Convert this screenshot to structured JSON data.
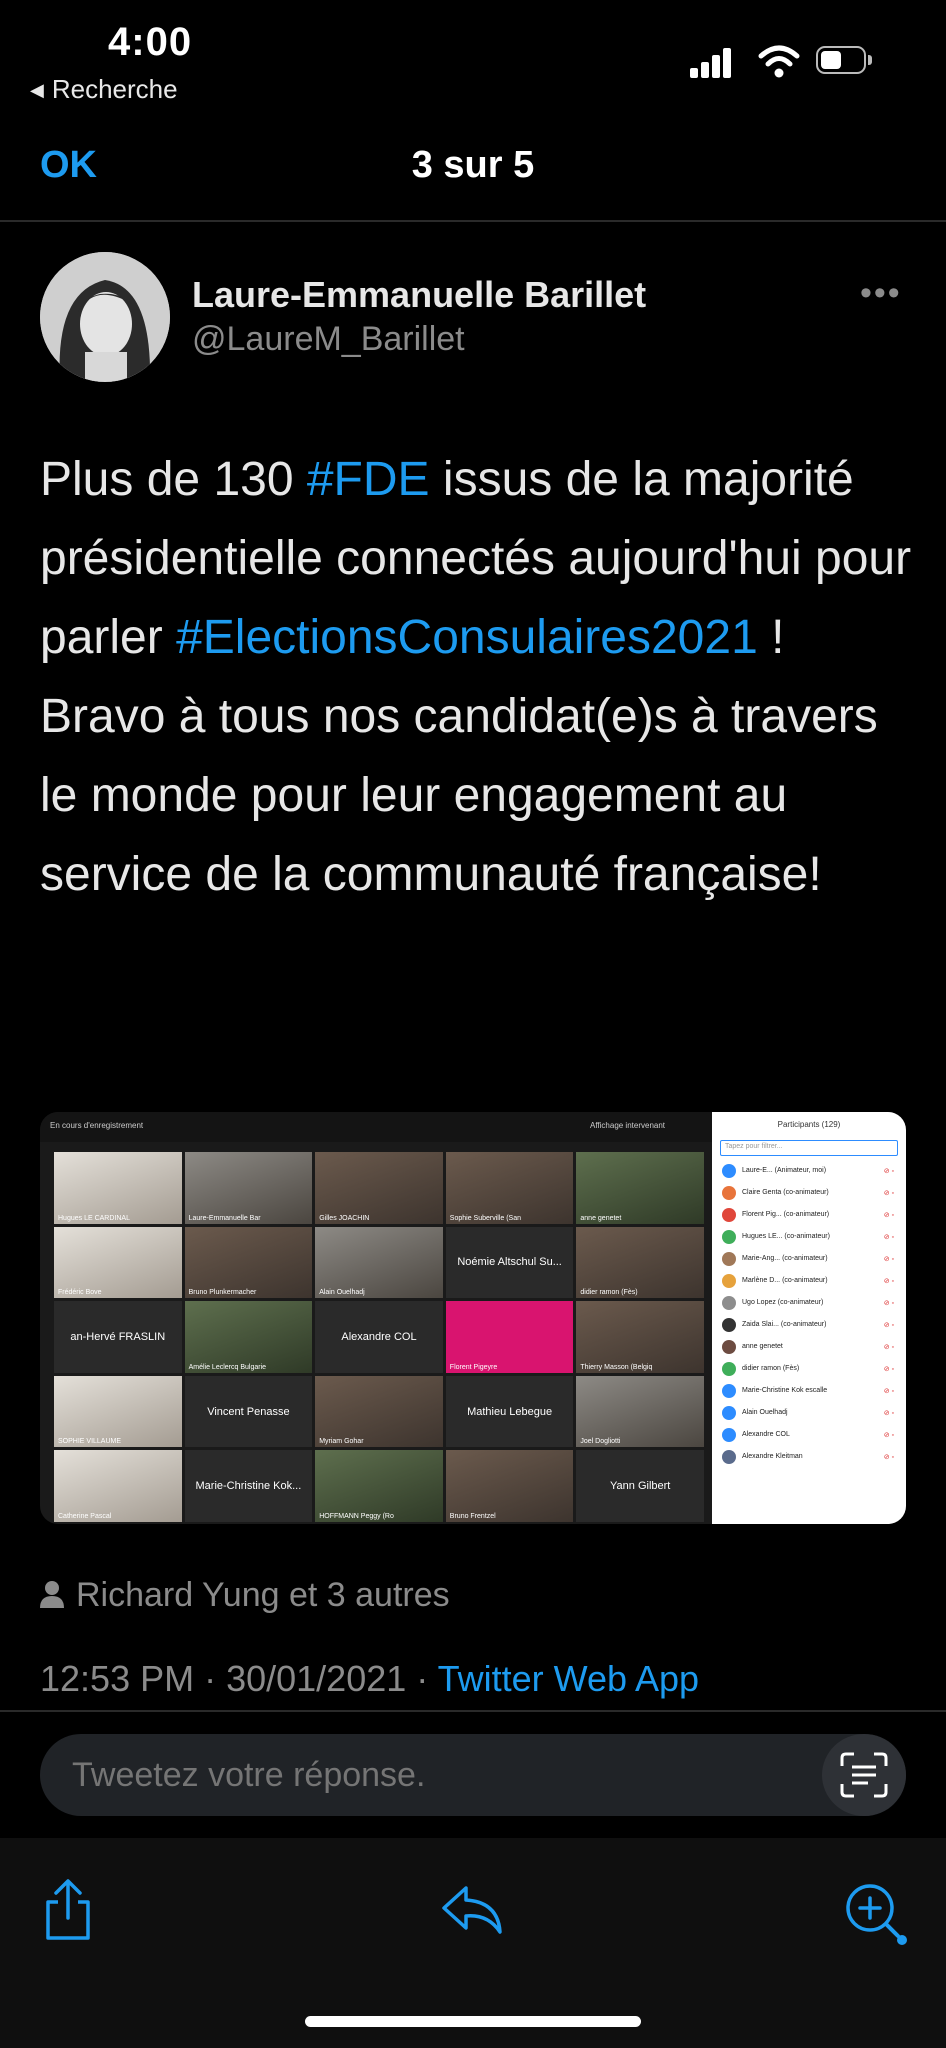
{
  "status_bar": {
    "time": "4:00",
    "back_label": "Recherche"
  },
  "nav": {
    "ok_label": "OK",
    "title": "3 sur 5"
  },
  "author": {
    "name": "Laure-Emmanuelle Barillet",
    "handle": "@LaureM_Barillet"
  },
  "tweet": {
    "part1": "Plus de 130 ",
    "hashtag1": "#FDE",
    "part2": " issus de la majorité présidentielle connectés aujourd'hui pour parler ",
    "hashtag2": "#ElectionsConsulaires2021",
    "part3": " ! Bravo à tous nos candidat(e)s à travers le monde pour leur engagement au service de  la communauté française!"
  },
  "media": {
    "toolbar_left": "En cours d'enregistrement",
    "toolbar_right": "Affichage intervenant",
    "tiles": [
      {
        "label": "Hugues LE CARDINAL",
        "style": "ph4",
        "center": false
      },
      {
        "label": "Laure-Emmanuelle Bar",
        "style": "ph2",
        "center": false
      },
      {
        "label": "Gilles JOACHIN",
        "style": "ph",
        "center": false
      },
      {
        "label": "Sophie Suberville (San",
        "style": "ph",
        "center": false
      },
      {
        "label": "anne genetet",
        "style": "ph3",
        "center": false
      },
      {
        "label": "Frédéric Bove",
        "style": "ph4",
        "center": false
      },
      {
        "label": "Bruno Plunkermacher",
        "style": "ph",
        "center": false
      },
      {
        "label": "Alain Ouelhadj",
        "style": "ph2",
        "center": false
      },
      {
        "label": "Noémie Altschul Su...",
        "style": "",
        "center": true
      },
      {
        "label": "didier ramon (Fès)",
        "style": "ph",
        "center": false
      },
      {
        "label": "an-Hervé FRASLIN",
        "style": "",
        "center": true
      },
      {
        "label": "Amélie Leclercq Bulgarie",
        "style": "ph3",
        "center": false
      },
      {
        "label": "Alexandre COL",
        "style": "",
        "center": true
      },
      {
        "label": "Florent Pigeyre",
        "style": "pink",
        "center": false
      },
      {
        "label": "Thierry Masson (Belgiq",
        "style": "ph",
        "center": false
      },
      {
        "label": "SOPHIE VILLAUME",
        "style": "ph4",
        "center": false
      },
      {
        "label": "Vincent Penasse",
        "style": "",
        "center": true
      },
      {
        "label": "Myriam Gohar",
        "style": "ph",
        "center": false
      },
      {
        "label": "Mathieu Lebegue",
        "style": "",
        "center": true
      },
      {
        "label": "Joel Dogliotti",
        "style": "ph2",
        "center": false
      },
      {
        "label": "Catherine Pascal",
        "style": "ph4",
        "center": false
      },
      {
        "label": "Marie-Christine Kok...",
        "style": "",
        "center": true
      },
      {
        "label": "HOFFMANN Peggy (Ro",
        "style": "ph3",
        "center": false
      },
      {
        "label": "Bruno Frentzel",
        "style": "ph",
        "center": false
      },
      {
        "label": "Yann Gilbert",
        "style": "",
        "center": true
      }
    ],
    "panel_title": "Participants (129)",
    "panel_search_placeholder": "Tapez pour filtrer...",
    "participants": [
      {
        "name": "Laure-E...  (Animateur, moi)",
        "color": "#2d8cff"
      },
      {
        "name": "Claire Genta  (co-animateur)",
        "color": "#e8743b"
      },
      {
        "name": "Florent Pig...  (co-animateur)",
        "color": "#e0473b"
      },
      {
        "name": "Hugues LE...  (co-animateur)",
        "color": "#3fae5a"
      },
      {
        "name": "Marie-Ang...  (co-animateur)",
        "color": "#a07858"
      },
      {
        "name": "Marlène D...  (co-animateur)",
        "color": "#e6a23c"
      },
      {
        "name": "Ugo Lopez  (co-animateur)",
        "color": "#8d8d8d"
      },
      {
        "name": "Zaida Slai...  (co-animateur)",
        "color": "#333333"
      },
      {
        "name": "anne genetet",
        "color": "#6d4c41"
      },
      {
        "name": "didier ramon (Fès)",
        "color": "#3fae5a"
      },
      {
        "name": "Marie-Christine Kok escalle",
        "color": "#2d8cff"
      },
      {
        "name": "Alain Ouelhadj",
        "color": "#2d8cff"
      },
      {
        "name": "Alexandre COL",
        "color": "#2d8cff"
      },
      {
        "name": "Alexandre Kleitman",
        "color": "#5a6b8c"
      }
    ]
  },
  "likes": {
    "text": "Richard Yung et 3 autres"
  },
  "meta": {
    "time": "12:53 PM",
    "date": "30/01/2021",
    "source": "Twitter Web App",
    "separator": " · "
  },
  "reply": {
    "placeholder": "Tweetez votre réponse."
  },
  "colors": {
    "accent": "#1d9bf0",
    "background": "#000000",
    "muted": "#8b8b8b"
  },
  "icons": {
    "status": [
      "signal-icon",
      "wifi-icon",
      "battery-icon"
    ],
    "toolbar": [
      "share-icon",
      "reply-icon",
      "add-tweet-icon"
    ]
  }
}
